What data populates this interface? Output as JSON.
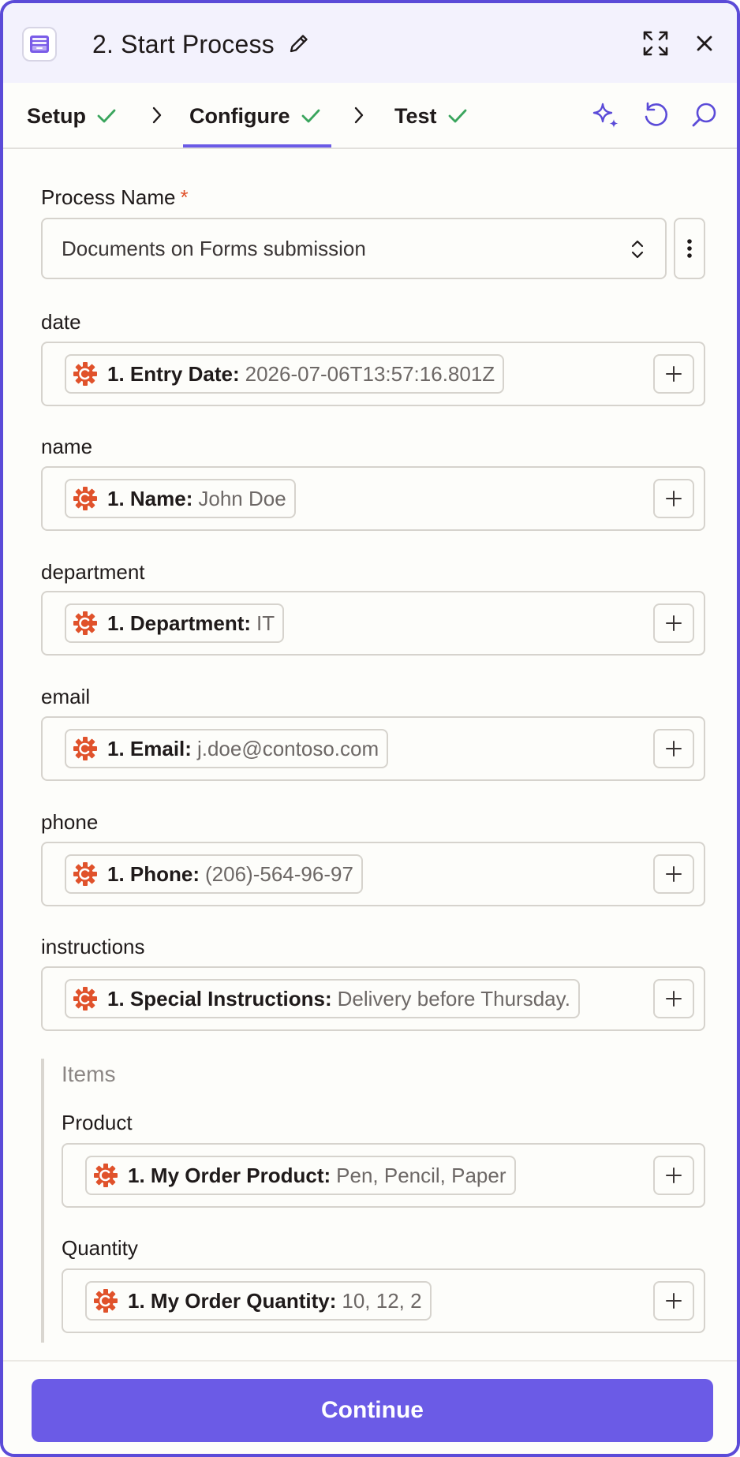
{
  "header": {
    "title": "2. Start Process",
    "icons": {
      "app": "archive-box-icon",
      "edit": "pencil-icon",
      "expand": "expand-icon",
      "close": "close-icon"
    }
  },
  "tabs": [
    {
      "label": "Setup",
      "complete": true
    },
    {
      "label": "Configure",
      "complete": true,
      "active": true
    },
    {
      "label": "Test",
      "complete": true
    }
  ],
  "toolbar": {
    "icons": [
      "ai-sparkle-icon",
      "undo-icon",
      "search-icon"
    ]
  },
  "form": {
    "process_name": {
      "label": "Process Name",
      "required_mark": "*",
      "value": "Documents on Forms submission"
    },
    "fields": [
      {
        "label": "date",
        "pill_key": "1. Entry Date:",
        "pill_value": "2026-07-06T13:57:16.801Z"
      },
      {
        "label": "name",
        "pill_key": "1. Name:",
        "pill_value": "John Doe"
      },
      {
        "label": "department",
        "pill_key": "1. Department:",
        "pill_value": "IT"
      },
      {
        "label": "email",
        "pill_key": "1. Email:",
        "pill_value": "j.doe@contoso.com"
      },
      {
        "label": "phone",
        "pill_key": "1. Phone:",
        "pill_value": "(206)-564-96-97"
      },
      {
        "label": "instructions",
        "pill_key": "1. Special Instructions:",
        "pill_value": "Delivery before Thursday."
      }
    ],
    "items": {
      "title": "Items",
      "fields": [
        {
          "label": "Product",
          "pill_key": "1. My Order Product:",
          "pill_value": "Pen, Pencil, Paper"
        },
        {
          "label": "Quantity",
          "pill_key": "1. My Order Quantity:",
          "pill_value": "10, 12, 2"
        }
      ]
    }
  },
  "footer": {
    "continue_label": "Continue"
  },
  "colors": {
    "accent": "#6b5be6",
    "check": "#3aa55d",
    "gear": "#e0522b",
    "required": "#e0522b"
  }
}
